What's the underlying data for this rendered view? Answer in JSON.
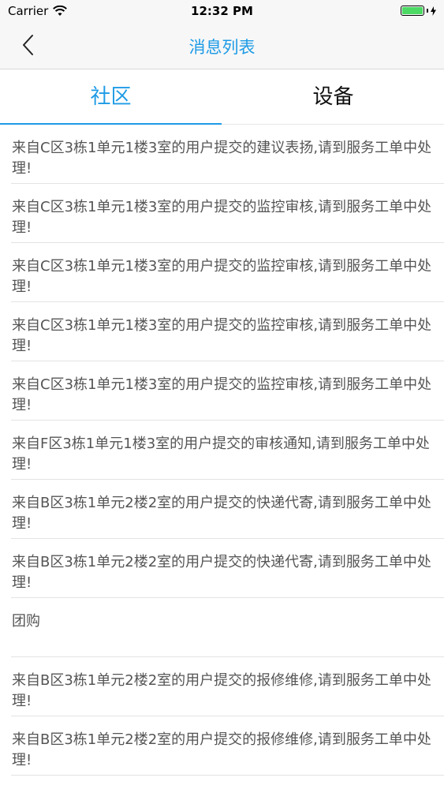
{
  "status_bar": {
    "carrier": "Carrier",
    "time": "12:32 PM",
    "battery_level": 1.0
  },
  "nav": {
    "back_icon": "chevron-left-icon",
    "title": "消息列表"
  },
  "tabs": [
    {
      "label": "社区",
      "active": true
    },
    {
      "label": "设备",
      "active": false
    }
  ],
  "colors": {
    "accent": "#1e9be6",
    "text": "#555555",
    "battery": "#4cd964"
  },
  "messages": [
    {
      "text": "来自C区3栋1单元1楼3室的用户提交的建议表扬,请到服务工单中处理!"
    },
    {
      "text": "来自C区3栋1单元1楼3室的用户提交的监控审核,请到服务工单中处理!"
    },
    {
      "text": "来自C区3栋1单元1楼3室的用户提交的监控审核,请到服务工单中处理!"
    },
    {
      "text": "来自C区3栋1单元1楼3室的用户提交的监控审核,请到服务工单中处理!"
    },
    {
      "text": "来自C区3栋1单元1楼3室的用户提交的监控审核,请到服务工单中处理!"
    },
    {
      "text": "来自F区3栋1单元1楼3室的用户提交的审核通知,请到服务工单中处理!"
    },
    {
      "text": "来自B区3栋1单元2楼2室的用户提交的快递代寄,请到服务工单中处理!"
    },
    {
      "text": "来自B区3栋1单元2楼2室的用户提交的快递代寄,请到服务工单中处理!"
    },
    {
      "text": "团购"
    },
    {
      "text": "来自B区3栋1单元2楼2室的用户提交的报修维修,请到服务工单中处理!"
    },
    {
      "text": "来自B区3栋1单元2楼2室的用户提交的报修维修,请到服务工单中处理!"
    }
  ]
}
